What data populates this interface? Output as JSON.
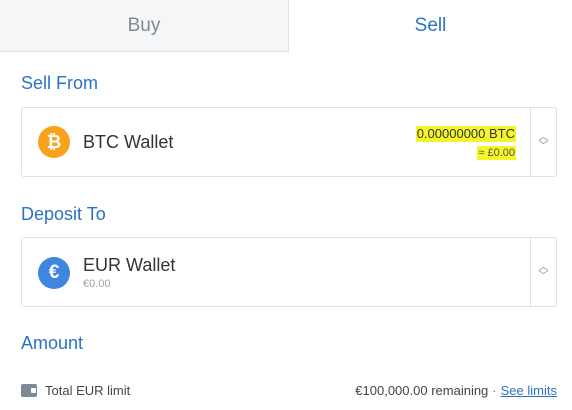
{
  "tabs": {
    "buy": "Buy",
    "sell": "Sell"
  },
  "sell_from": {
    "label": "Sell From",
    "wallet_name": "BTC Wallet",
    "icon": "bitcoin-icon",
    "icon_glyph": "₿",
    "icon_color": "#f7a21b",
    "balance_btc": "0.00000000 BTC",
    "balance_fiat": "≈ £0.00"
  },
  "deposit_to": {
    "label": "Deposit To",
    "wallet_name": "EUR Wallet",
    "icon": "euro-icon",
    "icon_glyph": "€",
    "icon_color": "#3e86df",
    "balance": "€0.00"
  },
  "amount": {
    "label": "Amount"
  },
  "limit": {
    "label": "Total EUR limit",
    "remaining": "€100,000.00 remaining",
    "separator": "·",
    "link": "See limits"
  },
  "colors": {
    "accent": "#2b72c2",
    "highlight": "#f5f52a"
  }
}
